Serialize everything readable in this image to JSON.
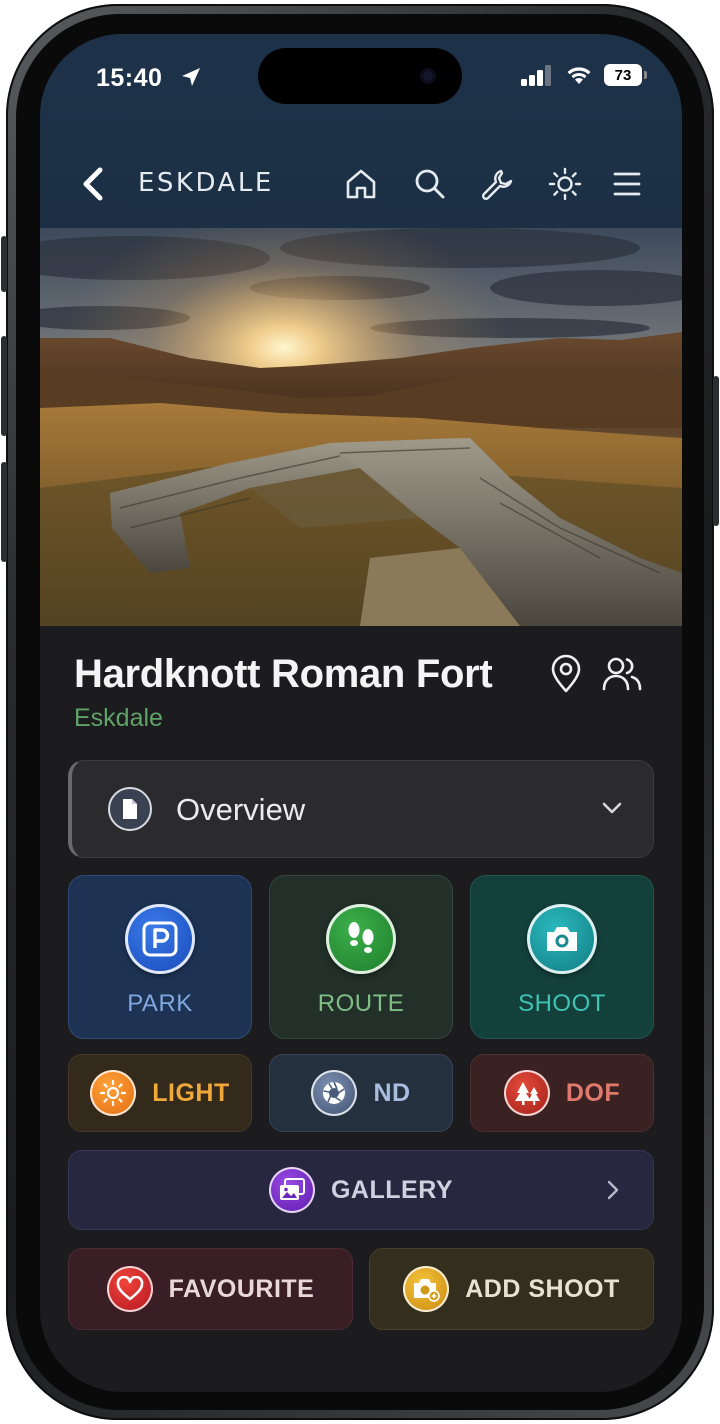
{
  "status": {
    "time": "15:40",
    "battery": "73"
  },
  "nav": {
    "title": "ESKDALE",
    "icons": [
      "back-chevron-icon",
      "home-icon",
      "search-icon",
      "wrench-icon",
      "sun-icon",
      "menu-icon"
    ]
  },
  "place": {
    "title": "Hardknott Roman Fort",
    "subtitle": "Eskdale"
  },
  "overview": {
    "label": "Overview"
  },
  "tiles": [
    {
      "label": "PARK",
      "icon": "parking-icon"
    },
    {
      "label": "ROUTE",
      "icon": "footsteps-icon"
    },
    {
      "label": "SHOOT",
      "icon": "camera-icon"
    }
  ],
  "pills": [
    {
      "label": "LIGHT",
      "icon": "sun-icon"
    },
    {
      "label": "ND",
      "icon": "aperture-icon"
    },
    {
      "label": "DOF",
      "icon": "trees-icon"
    }
  ],
  "gallery": {
    "label": "GALLERY"
  },
  "actions": [
    {
      "label": "FAVOURITE",
      "icon": "heart-icon"
    },
    {
      "label": "ADD SHOOT",
      "icon": "add-camera-icon"
    }
  ],
  "colors": {
    "header_bg": "#1d3249",
    "screen_bg": "#1c1c1e",
    "subtitle": "#5fa36a",
    "park": "#7fa8e0",
    "route": "#7fbf86",
    "shoot": "#3fc3b4",
    "light": "#f0a83a",
    "nd": "#a9bede",
    "dof": "#e07a6e",
    "gallery": "#cfd0e0",
    "favourite": "#e8d8d8",
    "add_shoot": "#e8e2d0"
  }
}
